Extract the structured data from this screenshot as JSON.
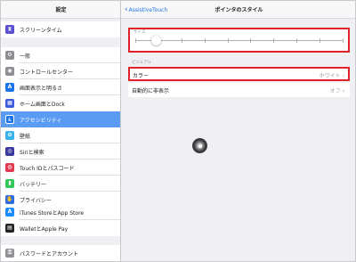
{
  "sidebar": {
    "title": "設定",
    "items": [
      {
        "label": "スクリーンタイム",
        "icon": "hourglass-icon",
        "color": "#5a4fcf",
        "glyph": "⧗"
      },
      {
        "label": "一般",
        "icon": "gear-icon",
        "color": "#8e8e93",
        "glyph": "⚙"
      },
      {
        "label": "コントロールセンター",
        "icon": "switches-icon",
        "color": "#8e8e93",
        "glyph": "◉"
      },
      {
        "label": "画面表示と明るさ",
        "icon": "text-size-icon",
        "color": "#1a73e8",
        "glyph": "A"
      },
      {
        "label": "ホーム画面とDock",
        "icon": "grid-icon",
        "color": "#3b5bdb",
        "glyph": "▦"
      },
      {
        "label": "アクセシビリティ",
        "icon": "accessibility-icon",
        "color": "#1a73e8",
        "glyph": "♿"
      },
      {
        "label": "壁紙",
        "icon": "flower-icon",
        "color": "#38b2e8",
        "glyph": "✿"
      },
      {
        "label": "Siriと検索",
        "icon": "siri-icon",
        "color": "#3a3a9e",
        "glyph": "◎"
      },
      {
        "label": "Touch IDとパスコード",
        "icon": "fingerprint-icon",
        "color": "#e0394d",
        "glyph": "◍"
      },
      {
        "label": "バッテリー",
        "icon": "battery-icon",
        "color": "#34c759",
        "glyph": "▮"
      },
      {
        "label": "プライバシー",
        "icon": "hand-icon",
        "color": "#2d6cdf",
        "glyph": "✋"
      },
      {
        "label": "iTunes StoreとApp Store",
        "icon": "app-store-icon",
        "color": "#1a8cff",
        "glyph": "A"
      },
      {
        "label": "WalletとApple Pay",
        "icon": "wallet-icon",
        "color": "#222222",
        "glyph": "▤"
      },
      {
        "label": "パスワードとアカウント",
        "icon": "key-icon",
        "color": "#8e8e93",
        "glyph": "⚿"
      }
    ],
    "selected_index": 5
  },
  "nav": {
    "back_label": "AssistiveTouch",
    "title": "ポインタのスタイル"
  },
  "size_section": {
    "label": "サイズ",
    "slider_fraction": 0.1,
    "tick_count": 10
  },
  "visual_section": {
    "label": "ビジュアル",
    "color_row": {
      "label": "カラー",
      "value": "ホワイト"
    },
    "autohide_row": {
      "label": "自動的に非表示",
      "value": "オフ"
    }
  },
  "colors": {
    "accent": "#1a73e8",
    "selection": "#5a9cf3",
    "highlight_border": "#e0202a"
  }
}
